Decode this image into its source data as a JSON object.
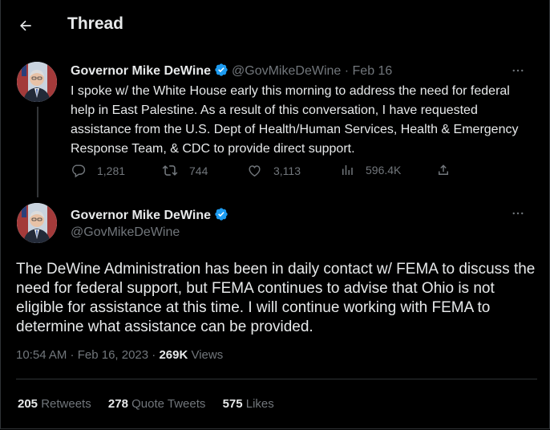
{
  "header": {
    "title": "Thread"
  },
  "tweet1": {
    "name": "Governor Mike DeWine",
    "handle": "@GovMikeDeWine",
    "date_line": " · Feb 16",
    "text": "I spoke w/ the White House early this morning to address the need for federal help in East Palestine. As a result of this conversation, I have requested assistance from the U.S. Dept of Health/Human Services, Health & Emergency Response Team, & CDC to provide direct support.",
    "replies": "1,281",
    "retweets": "744",
    "likes": "3,113",
    "views": "596.4K"
  },
  "tweet2": {
    "name": "Governor Mike DeWine",
    "handle": "@GovMikeDeWine",
    "text": "The DeWine Administration has been in daily contact w/ FEMA to discuss the need for federal support, but  FEMA continues to advise that Ohio is not eligible for assistance at this time. I will continue working with FEMA to determine what assistance can be provided.",
    "timestamp": "10:54 AM · Feb 16, 2023 · ",
    "views_count": "269K",
    "views_label": " Views",
    "retweets_count": "205",
    "retweets_label": " Retweets",
    "quotes_count": "278",
    "quotes_label": " Quote Tweets",
    "likes_count": "575",
    "likes_label": " Likes"
  },
  "icons": {
    "back": "arrow-left-icon",
    "verified": "verified-badge-icon",
    "more": "more-horizontal-icon",
    "reply": "reply-icon",
    "retweet": "retweet-icon",
    "like": "heart-icon",
    "views": "views-chart-icon",
    "share": "share-icon"
  },
  "colors": {
    "background": "#000000",
    "text": "#e7e9ea",
    "muted": "#71767b",
    "verified": "#1d9bf0",
    "border": "#2f3336"
  }
}
